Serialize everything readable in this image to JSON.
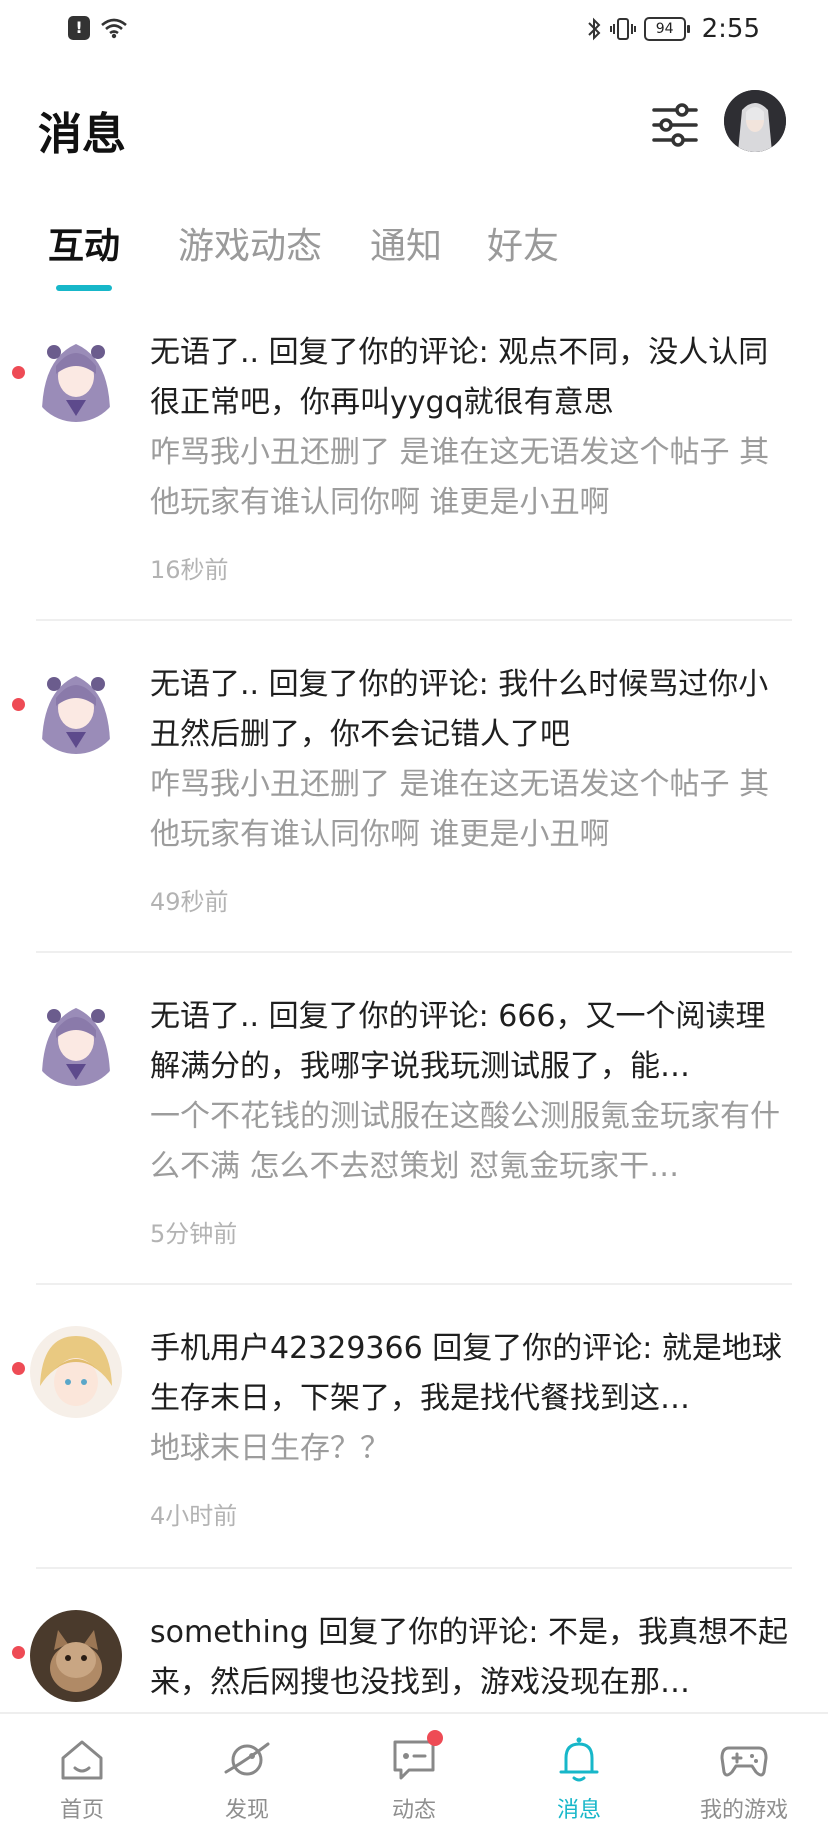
{
  "status_bar": {
    "battery": "94",
    "time": "2:55"
  },
  "header": {
    "title": "消息"
  },
  "tabs": [
    {
      "label": "互动",
      "active": true
    },
    {
      "label": "游戏动态",
      "active": false
    },
    {
      "label": "通知",
      "active": false
    },
    {
      "label": "好友",
      "active": false
    }
  ],
  "messages": [
    {
      "main": "无语了.. 回复了你的评论: 观点不同，没人认同很正常吧，你再叫yygq就很有意思",
      "quote": "咋骂我小丑还删了 是谁在这无语发这个帖子 其他玩家有谁认同你啊 谁更是小丑啊",
      "time": "16秒前",
      "unread": true
    },
    {
      "main": "无语了.. 回复了你的评论: 我什么时候骂过你小丑然后删了，你不会记错人了吧",
      "quote": "咋骂我小丑还删了 是谁在这无语发这个帖子 其他玩家有谁认同你啊 谁更是小丑啊",
      "time": "49秒前",
      "unread": true
    },
    {
      "main": "无语了.. 回复了你的评论: 666，又一个阅读理解满分的，我哪字说我玩测试服了，能…",
      "quote": "一个不花钱的测试服在这酸公测服氪金玩家有什么不满 怎么不去怼策划 怼氪金玩家干…",
      "time": "5分钟前",
      "unread": true
    },
    {
      "main": "手机用户42329366 回复了你的评论: 就是地球生存末日，下架了，我是找代餐找到这…",
      "quote": "地球末日生存？？",
      "time": "4小时前",
      "unread": true
    },
    {
      "main": "something 回复了你的评论: 不是，我真想不起来，然后网搜也没找到，游戏没现在那…",
      "quote": "",
      "time": "",
      "unread": true
    }
  ],
  "bottom_nav": [
    {
      "label": "首页",
      "icon": "home-icon",
      "active": false
    },
    {
      "label": "发现",
      "icon": "planet-icon",
      "active": false
    },
    {
      "label": "动态",
      "icon": "chat-icon",
      "active": false,
      "badge": true
    },
    {
      "label": "消息",
      "icon": "bell-icon",
      "active": true
    },
    {
      "label": "我的游戏",
      "icon": "gamepad-icon",
      "active": false
    }
  ],
  "colors": {
    "accent": "#17b7c9",
    "unread": "#ee4b55"
  }
}
